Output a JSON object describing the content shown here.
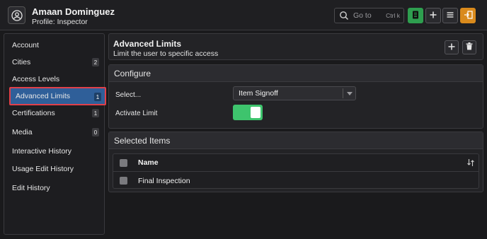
{
  "header": {
    "user_name": "Amaan Dominguez",
    "profile": "Profile: Inspector",
    "search_placeholder": "Go to",
    "search_shortcut": "Ctrl k",
    "icons": [
      "user-circle-icon",
      "search-icon",
      "document-icon",
      "plus-icon",
      "menu-icon",
      "switch-user-icon"
    ],
    "accent_green": "#2e9e4f",
    "accent_orange": "#d98a1c"
  },
  "sidebar": {
    "items": [
      {
        "label": "Account",
        "badge": ""
      },
      {
        "label": "Cities",
        "badge": "2"
      },
      {
        "label": "Access Levels",
        "badge": ""
      },
      {
        "label": "Advanced Limits",
        "badge": "1",
        "active": true
      },
      {
        "label": "Certifications",
        "badge": "1"
      },
      {
        "label": "Media",
        "badge": "0"
      },
      {
        "label": "Interactive History",
        "badge": ""
      },
      {
        "label": "Usage Edit History",
        "badge": ""
      },
      {
        "label": "Edit History",
        "badge": ""
      }
    ],
    "active_color": "#2f5f99"
  },
  "main": {
    "title": "Advanced Limits",
    "subtitle": "Limit the user to specific access",
    "configure": {
      "heading": "Configure",
      "select_label": "Select...",
      "select_value": "Item Signoff",
      "activate_label": "Activate Limit",
      "activate_on": true,
      "toggle_color": "#3ec46d"
    },
    "selected_items": {
      "heading": "Selected Items",
      "column_name": "Name",
      "rows": [
        "Final Inspection"
      ]
    }
  }
}
